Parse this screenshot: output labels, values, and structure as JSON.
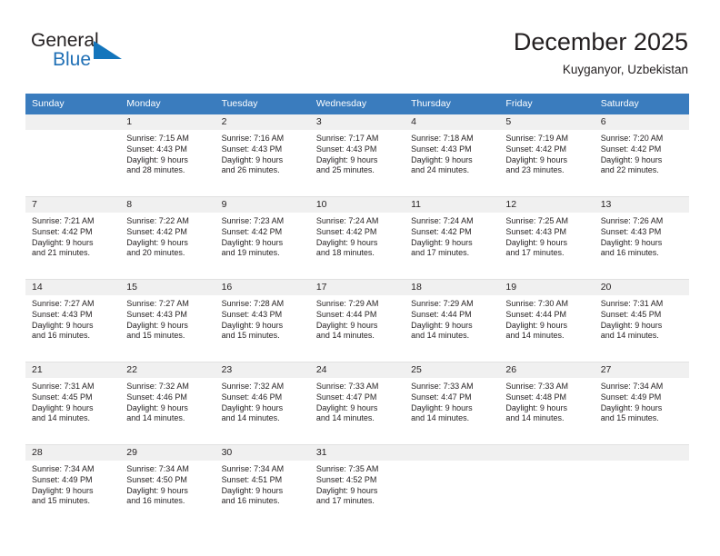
{
  "brand": {
    "name_part1": "General",
    "name_part2": "Blue",
    "accent_color": "#1375bc"
  },
  "header": {
    "title": "December 2025",
    "location": "Kuyganyor, Uzbekistan",
    "header_bg_color": "#3a7cbe",
    "day_band_color": "#f0f0f0"
  },
  "weekday_headers": [
    "Sunday",
    "Monday",
    "Tuesday",
    "Wednesday",
    "Thursday",
    "Friday",
    "Saturday"
  ],
  "weeks": [
    [
      {
        "empty": true
      },
      {
        "day": "1",
        "sunrise": "Sunrise: 7:15 AM",
        "sunset": "Sunset: 4:43 PM",
        "daylight_line1": "Daylight: 9 hours",
        "daylight_line2": "and 28 minutes."
      },
      {
        "day": "2",
        "sunrise": "Sunrise: 7:16 AM",
        "sunset": "Sunset: 4:43 PM",
        "daylight_line1": "Daylight: 9 hours",
        "daylight_line2": "and 26 minutes."
      },
      {
        "day": "3",
        "sunrise": "Sunrise: 7:17 AM",
        "sunset": "Sunset: 4:43 PM",
        "daylight_line1": "Daylight: 9 hours",
        "daylight_line2": "and 25 minutes."
      },
      {
        "day": "4",
        "sunrise": "Sunrise: 7:18 AM",
        "sunset": "Sunset: 4:43 PM",
        "daylight_line1": "Daylight: 9 hours",
        "daylight_line2": "and 24 minutes."
      },
      {
        "day": "5",
        "sunrise": "Sunrise: 7:19 AM",
        "sunset": "Sunset: 4:42 PM",
        "daylight_line1": "Daylight: 9 hours",
        "daylight_line2": "and 23 minutes."
      },
      {
        "day": "6",
        "sunrise": "Sunrise: 7:20 AM",
        "sunset": "Sunset: 4:42 PM",
        "daylight_line1": "Daylight: 9 hours",
        "daylight_line2": "and 22 minutes."
      }
    ],
    [
      {
        "day": "7",
        "sunrise": "Sunrise: 7:21 AM",
        "sunset": "Sunset: 4:42 PM",
        "daylight_line1": "Daylight: 9 hours",
        "daylight_line2": "and 21 minutes."
      },
      {
        "day": "8",
        "sunrise": "Sunrise: 7:22 AM",
        "sunset": "Sunset: 4:42 PM",
        "daylight_line1": "Daylight: 9 hours",
        "daylight_line2": "and 20 minutes."
      },
      {
        "day": "9",
        "sunrise": "Sunrise: 7:23 AM",
        "sunset": "Sunset: 4:42 PM",
        "daylight_line1": "Daylight: 9 hours",
        "daylight_line2": "and 19 minutes."
      },
      {
        "day": "10",
        "sunrise": "Sunrise: 7:24 AM",
        "sunset": "Sunset: 4:42 PM",
        "daylight_line1": "Daylight: 9 hours",
        "daylight_line2": "and 18 minutes."
      },
      {
        "day": "11",
        "sunrise": "Sunrise: 7:24 AM",
        "sunset": "Sunset: 4:42 PM",
        "daylight_line1": "Daylight: 9 hours",
        "daylight_line2": "and 17 minutes."
      },
      {
        "day": "12",
        "sunrise": "Sunrise: 7:25 AM",
        "sunset": "Sunset: 4:43 PM",
        "daylight_line1": "Daylight: 9 hours",
        "daylight_line2": "and 17 minutes."
      },
      {
        "day": "13",
        "sunrise": "Sunrise: 7:26 AM",
        "sunset": "Sunset: 4:43 PM",
        "daylight_line1": "Daylight: 9 hours",
        "daylight_line2": "and 16 minutes."
      }
    ],
    [
      {
        "day": "14",
        "sunrise": "Sunrise: 7:27 AM",
        "sunset": "Sunset: 4:43 PM",
        "daylight_line1": "Daylight: 9 hours",
        "daylight_line2": "and 16 minutes."
      },
      {
        "day": "15",
        "sunrise": "Sunrise: 7:27 AM",
        "sunset": "Sunset: 4:43 PM",
        "daylight_line1": "Daylight: 9 hours",
        "daylight_line2": "and 15 minutes."
      },
      {
        "day": "16",
        "sunrise": "Sunrise: 7:28 AM",
        "sunset": "Sunset: 4:43 PM",
        "daylight_line1": "Daylight: 9 hours",
        "daylight_line2": "and 15 minutes."
      },
      {
        "day": "17",
        "sunrise": "Sunrise: 7:29 AM",
        "sunset": "Sunset: 4:44 PM",
        "daylight_line1": "Daylight: 9 hours",
        "daylight_line2": "and 14 minutes."
      },
      {
        "day": "18",
        "sunrise": "Sunrise: 7:29 AM",
        "sunset": "Sunset: 4:44 PM",
        "daylight_line1": "Daylight: 9 hours",
        "daylight_line2": "and 14 minutes."
      },
      {
        "day": "19",
        "sunrise": "Sunrise: 7:30 AM",
        "sunset": "Sunset: 4:44 PM",
        "daylight_line1": "Daylight: 9 hours",
        "daylight_line2": "and 14 minutes."
      },
      {
        "day": "20",
        "sunrise": "Sunrise: 7:31 AM",
        "sunset": "Sunset: 4:45 PM",
        "daylight_line1": "Daylight: 9 hours",
        "daylight_line2": "and 14 minutes."
      }
    ],
    [
      {
        "day": "21",
        "sunrise": "Sunrise: 7:31 AM",
        "sunset": "Sunset: 4:45 PM",
        "daylight_line1": "Daylight: 9 hours",
        "daylight_line2": "and 14 minutes."
      },
      {
        "day": "22",
        "sunrise": "Sunrise: 7:32 AM",
        "sunset": "Sunset: 4:46 PM",
        "daylight_line1": "Daylight: 9 hours",
        "daylight_line2": "and 14 minutes."
      },
      {
        "day": "23",
        "sunrise": "Sunrise: 7:32 AM",
        "sunset": "Sunset: 4:46 PM",
        "daylight_line1": "Daylight: 9 hours",
        "daylight_line2": "and 14 minutes."
      },
      {
        "day": "24",
        "sunrise": "Sunrise: 7:33 AM",
        "sunset": "Sunset: 4:47 PM",
        "daylight_line1": "Daylight: 9 hours",
        "daylight_line2": "and 14 minutes."
      },
      {
        "day": "25",
        "sunrise": "Sunrise: 7:33 AM",
        "sunset": "Sunset: 4:47 PM",
        "daylight_line1": "Daylight: 9 hours",
        "daylight_line2": "and 14 minutes."
      },
      {
        "day": "26",
        "sunrise": "Sunrise: 7:33 AM",
        "sunset": "Sunset: 4:48 PM",
        "daylight_line1": "Daylight: 9 hours",
        "daylight_line2": "and 14 minutes."
      },
      {
        "day": "27",
        "sunrise": "Sunrise: 7:34 AM",
        "sunset": "Sunset: 4:49 PM",
        "daylight_line1": "Daylight: 9 hours",
        "daylight_line2": "and 15 minutes."
      }
    ],
    [
      {
        "day": "28",
        "sunrise": "Sunrise: 7:34 AM",
        "sunset": "Sunset: 4:49 PM",
        "daylight_line1": "Daylight: 9 hours",
        "daylight_line2": "and 15 minutes."
      },
      {
        "day": "29",
        "sunrise": "Sunrise: 7:34 AM",
        "sunset": "Sunset: 4:50 PM",
        "daylight_line1": "Daylight: 9 hours",
        "daylight_line2": "and 16 minutes."
      },
      {
        "day": "30",
        "sunrise": "Sunrise: 7:34 AM",
        "sunset": "Sunset: 4:51 PM",
        "daylight_line1": "Daylight: 9 hours",
        "daylight_line2": "and 16 minutes."
      },
      {
        "day": "31",
        "sunrise": "Sunrise: 7:35 AM",
        "sunset": "Sunset: 4:52 PM",
        "daylight_line1": "Daylight: 9 hours",
        "daylight_line2": "and 17 minutes."
      },
      {
        "empty": true
      },
      {
        "empty": true
      },
      {
        "empty": true
      }
    ]
  ]
}
